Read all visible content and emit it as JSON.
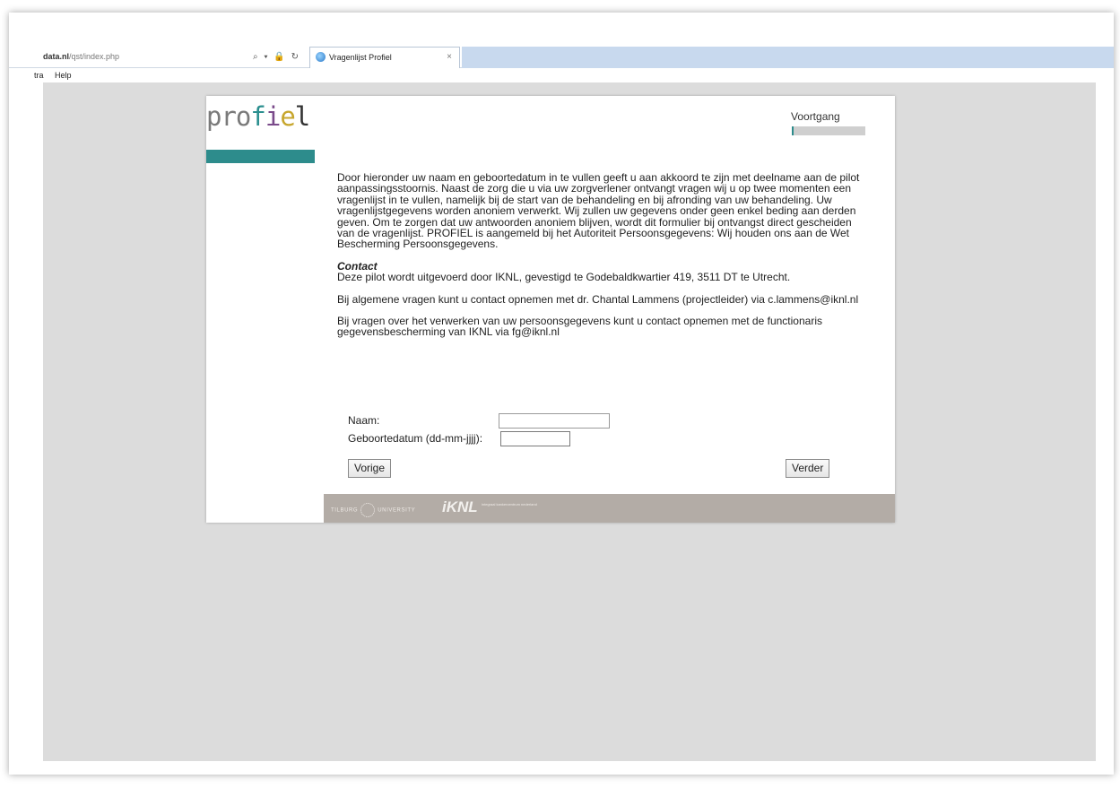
{
  "browser": {
    "address_bold": "data.nl",
    "address_rest": "/qst/index.php",
    "address_icons": "⌕ ▾ 🔒 ↻",
    "tab_title": "Vragenlijst Profiel",
    "tab_close": "×"
  },
  "menu": {
    "items": [
      "tra",
      "Help"
    ]
  },
  "header": {
    "logo_parts": [
      "pro",
      "f",
      "i",
      "e",
      "l"
    ],
    "progress_label": "Voortgang",
    "progress_fraction": 0.03,
    "accent_color": "#2d8c8c"
  },
  "content": {
    "intro": "Door hieronder uw naam en geboortedatum in te vullen geeft u aan akkoord te zijn met deelname aan de pilot aanpassingsstoornis. Naast de zorg die u via uw zorgverlener ontvangt vragen wij u op twee momenten een vragenlijst in te vullen, namelijk bij de start van de behandeling en bij afronding van uw behandeling. Uw vragenlijstgegevens worden anoniem verwerkt. Wij zullen uw gegevens onder geen enkel beding aan derden geven. Om te zorgen dat uw antwoorden anoniem blijven, wordt dit formulier bij ontvangst direct gescheiden van de vragenlijst. PROFIEL is aangemeld bij het Autoriteit Persoonsgegevens: Wij houden ons aan de Wet Bescherming Persoonsgegevens.",
    "contact_heading": "Contact",
    "contact_text": "Deze pilot wordt uitgevoerd door IKNL, gevestigd te Godebaldkwartier 419, 3511 DT te Utrecht.",
    "general_questions": "Bij algemene vragen kunt u contact opnemen met dr. Chantal Lammens (projectleider) via c.lammens@iknl.nl",
    "privacy_questions": "Bij vragen over het verwerken van uw persoonsgegevens kunt u contact opnemen met de functionaris gegevensbescherming van IKNL via fg@iknl.nl"
  },
  "form": {
    "name_label": "Naam:",
    "name_value": "",
    "dob_label": "Geboortedatum (dd-mm-jjjj):",
    "dob_value": "",
    "prev_button": "Vorige",
    "next_button": "Verder"
  },
  "footer": {
    "tilburg_left": "TILBURG",
    "tilburg_right": "UNIVERSITY",
    "iknl": "iKNL",
    "iknl_sub": "integraal kankercentrum nederland"
  }
}
